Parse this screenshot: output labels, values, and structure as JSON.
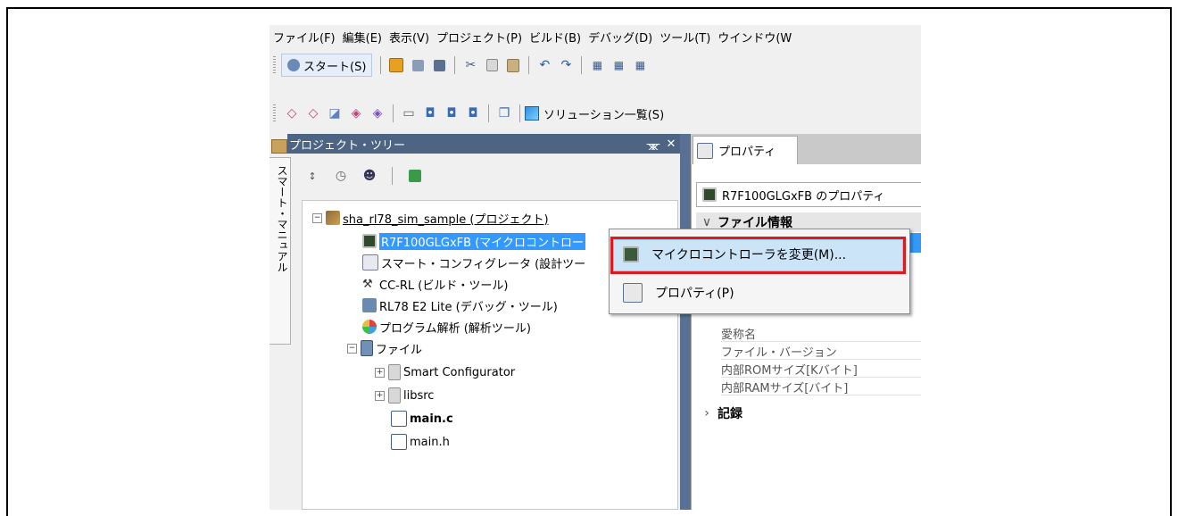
{
  "menu": [
    "ファイル(F)",
    "編集(E)",
    "表示(V)",
    "プロジェクト(P)",
    "ビルド(B)",
    "デバッグ(D)",
    "ツール(T)",
    "ウインドウ(W"
  ],
  "toolbar": {
    "start_label": "スタート(S)",
    "solution_label": "ソリューション一覧(S)"
  },
  "side_tab": "スマート・マニュアル",
  "project_tree": {
    "title": "プロジェクト・ツリー",
    "pin": "ᚘ",
    "close": "✕",
    "root": "sha_rl78_sim_sample (プロジェクト)",
    "items": [
      "R7F100GLGxFB (マイクロコントロー",
      "スマート・コンフィグレータ (設計ツー",
      "CC-RL (ビルド・ツール)",
      "RL78 E2 Lite (デバッグ・ツール)",
      "プログラム解析 (解析ツール)",
      "ファイル",
      "Smart Configurator",
      "libsrc",
      "main.c",
      "main.h"
    ]
  },
  "properties": {
    "tab": "プロパティ",
    "header": "R7F100GLGxFB のプロパティ",
    "category1": "ファイル情報",
    "rows": [
      "愛称名",
      "ファイル・バージョン",
      "内部ROMサイズ[Kバイト]",
      "内部RAMサイズ[バイト]"
    ],
    "category2": "記録"
  },
  "context_menu": {
    "items": [
      "マイクロコントローラを変更(M)...",
      "プロパティ(P)"
    ]
  },
  "colors": {
    "selection": "#3399ff",
    "titlebar": "#4d6482",
    "highlight_box": "#e0191e"
  }
}
